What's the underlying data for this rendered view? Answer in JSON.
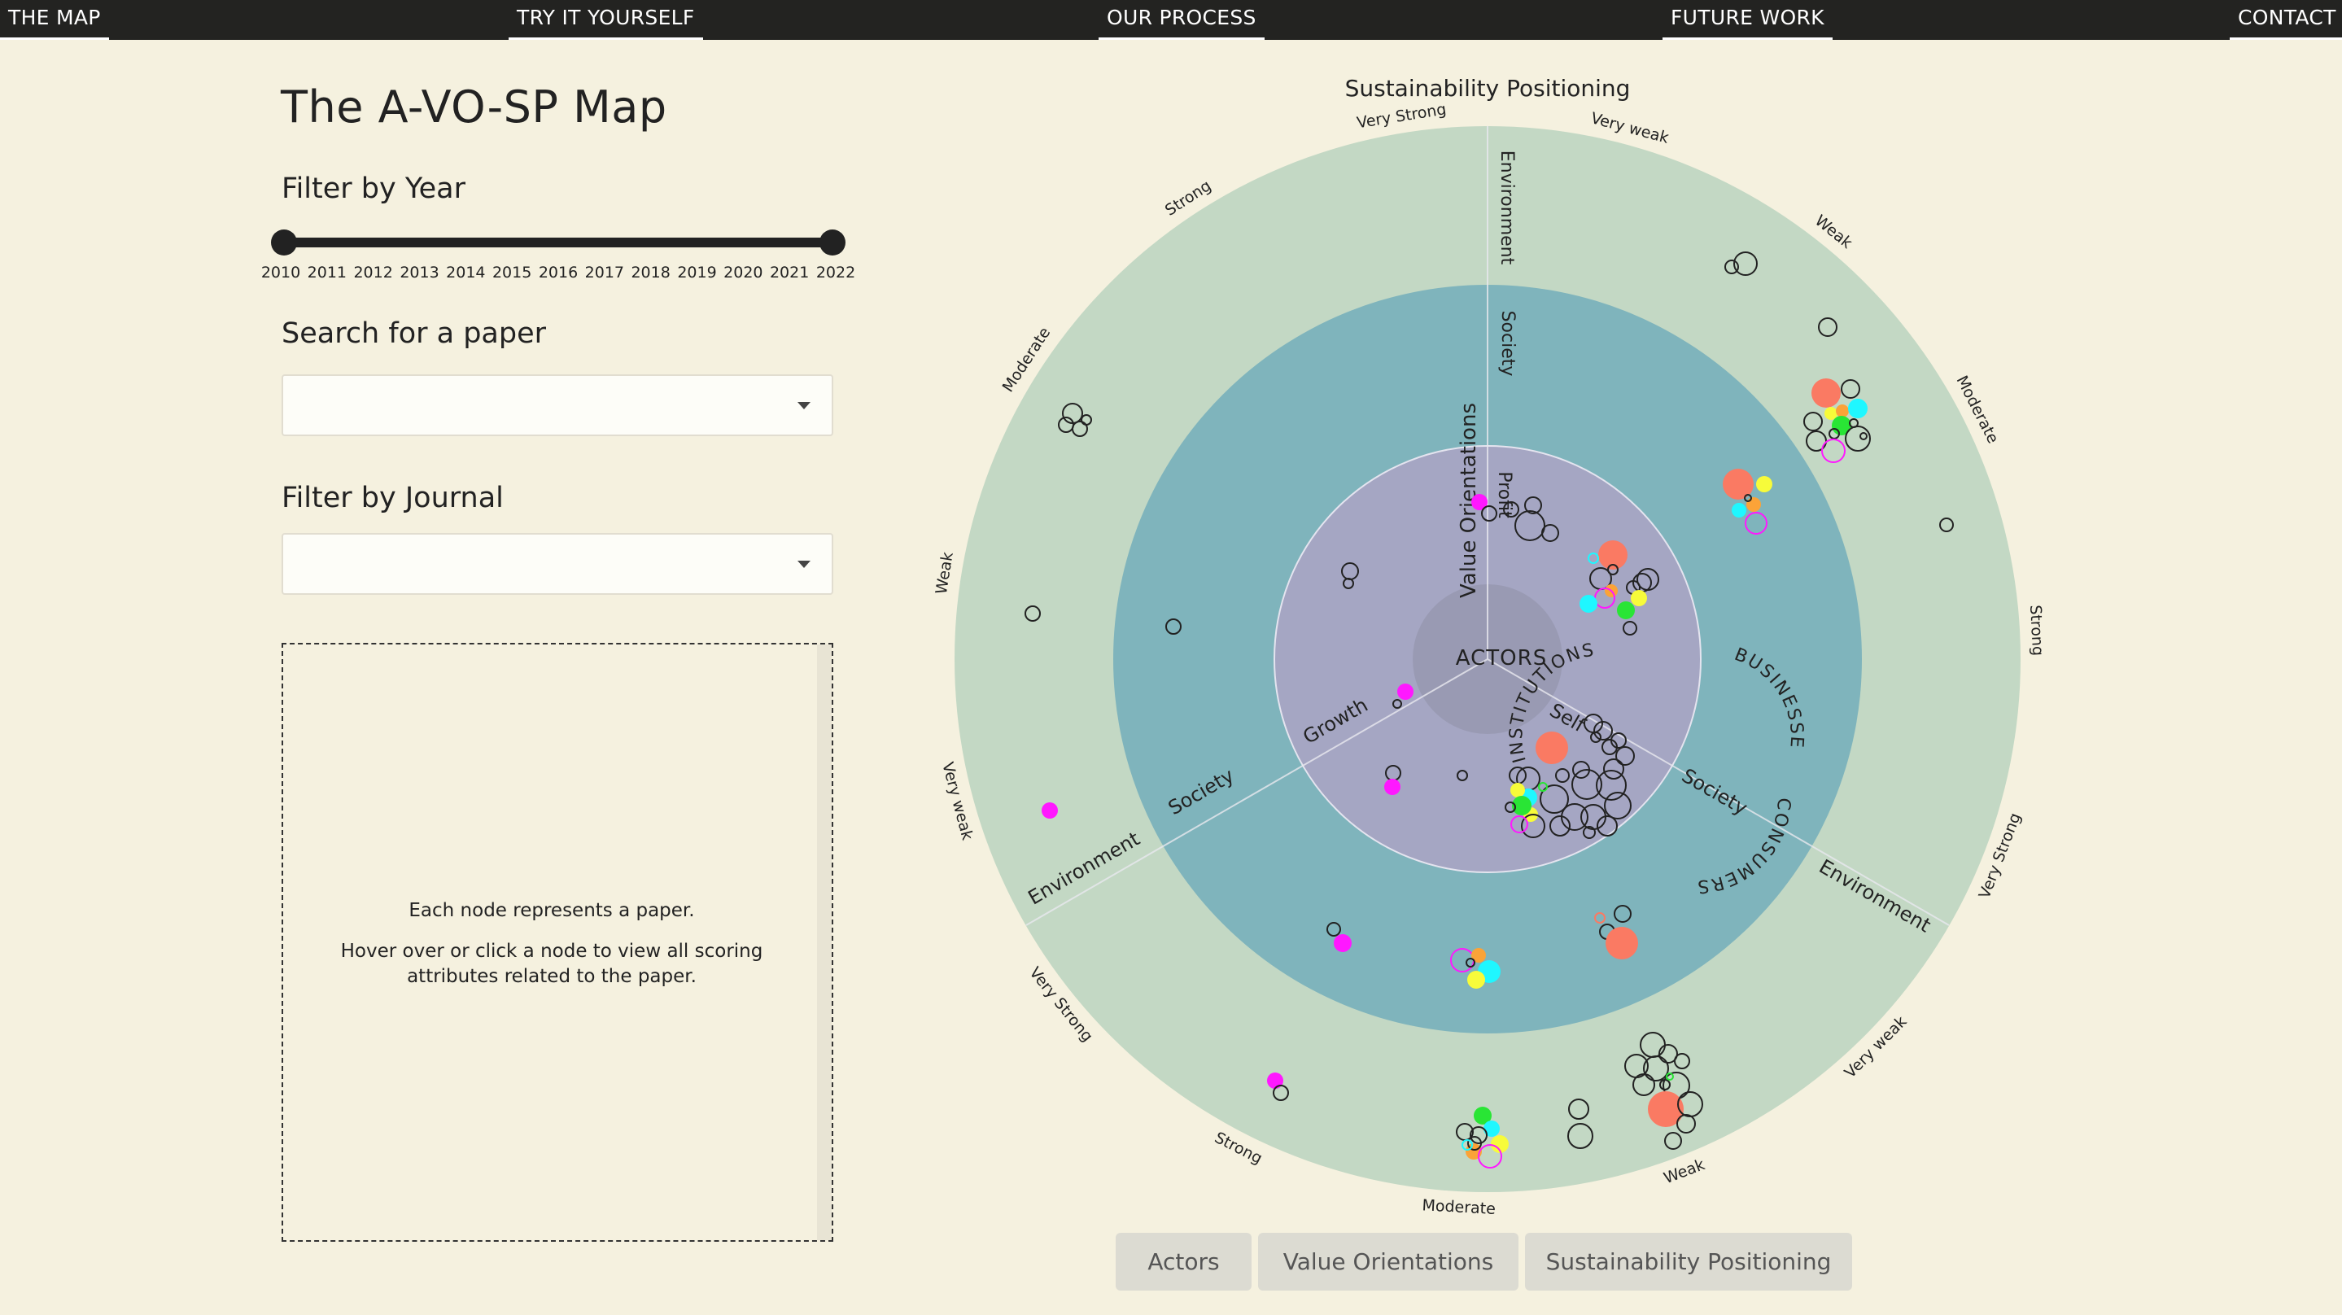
{
  "nav": {
    "items": [
      {
        "label": "THE MAP"
      },
      {
        "label": "TRY IT YOURSELF"
      },
      {
        "label": "OUR PROCESS"
      },
      {
        "label": "FUTURE WORK"
      },
      {
        "label": "CONTACT"
      }
    ]
  },
  "page_title": "The A-VO-SP Map",
  "year_filter": {
    "label": "Filter by Year",
    "min": 2010,
    "max": 2022,
    "selected": [
      2010,
      2022
    ],
    "ticks": [
      "2010",
      "2011",
      "2012",
      "2013",
      "2014",
      "2015",
      "2016",
      "2017",
      "2018",
      "2019",
      "2020",
      "2021",
      "2022"
    ]
  },
  "search": {
    "label": "Search for a paper",
    "value": ""
  },
  "journal_filter": {
    "label": "Filter by Journal",
    "value": ""
  },
  "info_panel": {
    "line1": "Each node represents a paper.",
    "line2": "Hover over or click a node to view all scoring",
    "line3": "attributes related to the paper."
  },
  "colors": {
    "outer_ring": "#c3d8c4",
    "middle_ring": "#7fb4bc",
    "inner_ring": "#a5a6c3",
    "center": "#999ab3",
    "paper_red": "#fa7a63",
    "paper_magenta": "#ff18ff",
    "paper_cyan": "#1ff7ff",
    "paper_yellow": "#f7fb3a",
    "paper_orange": "#fba338",
    "paper_green": "#29e535"
  },
  "diagram": {
    "title": "Sustainability Positioning",
    "center_label": "ACTORS",
    "actors": [
      "BUSINESSES",
      "CONSUMERS",
      "INSTITUTIONS"
    ],
    "value_orientations_label": "Value Orientations",
    "value_orientation_labels": [
      "Profit",
      "Growth",
      "Self"
    ],
    "middle_labels": [
      "Society",
      "Society",
      "Society"
    ],
    "outer_labels": [
      "Environment",
      "Environment",
      "Environment"
    ],
    "positioning_labels": [
      "Very Strong",
      "Very weak",
      "Weak",
      "Moderate",
      "Strong",
      "Very Strong",
      "Very weak",
      "Weak",
      "Moderate",
      "Strong",
      "Very Strong",
      "Very weak",
      "Weak",
      "Moderate",
      "Strong"
    ]
  },
  "bottom_buttons": [
    {
      "label": "Actors"
    },
    {
      "label": "Value Orientations"
    },
    {
      "label": "Sustainability Positioning"
    }
  ]
}
